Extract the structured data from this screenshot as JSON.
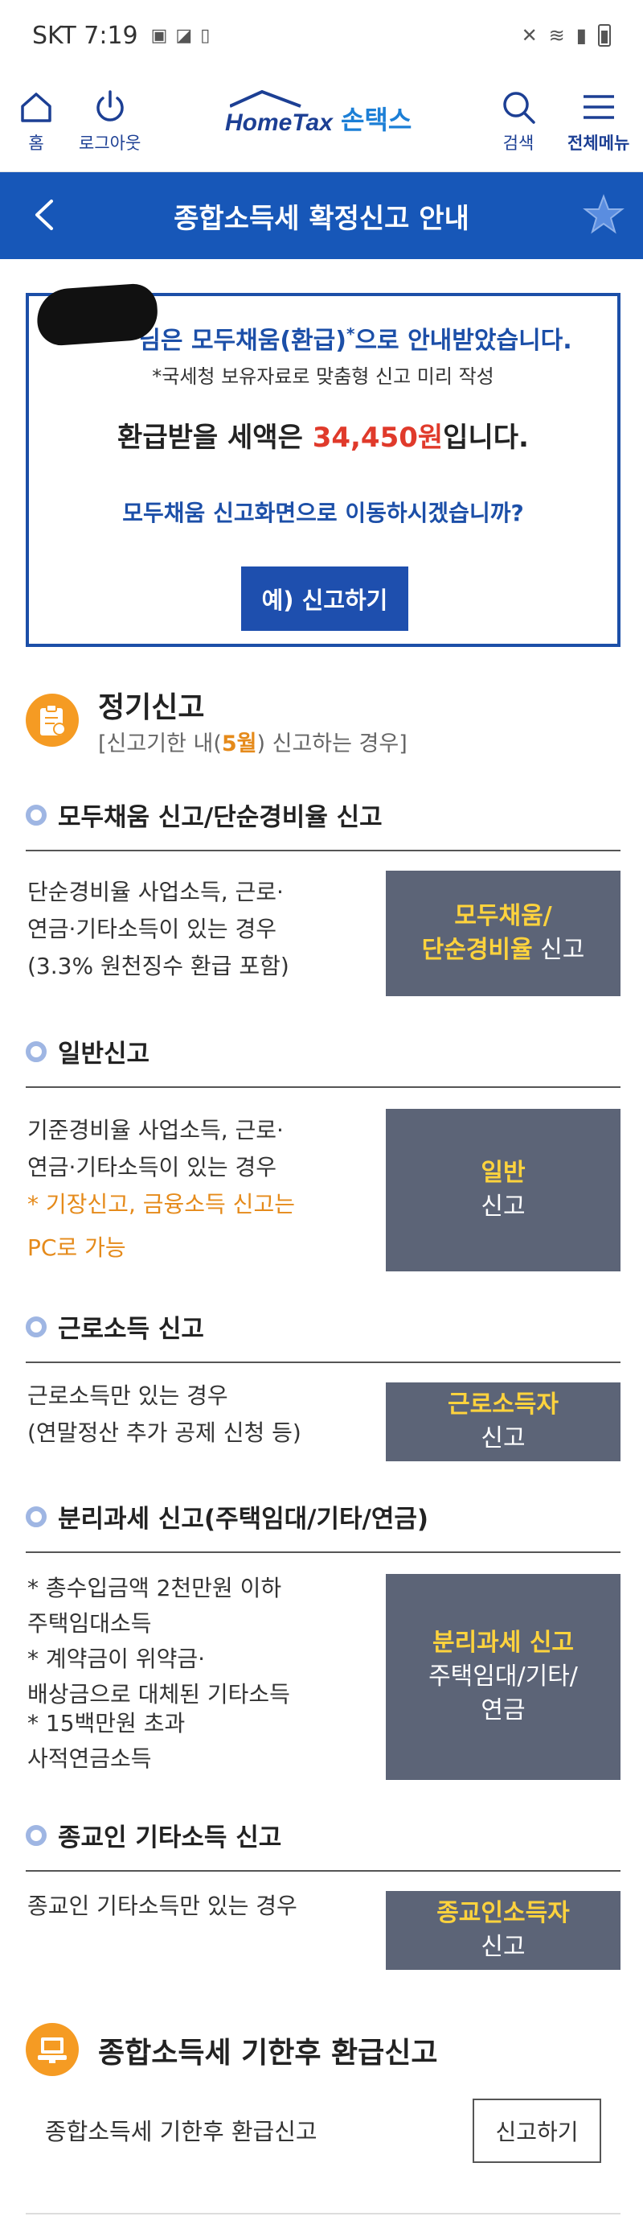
{
  "status_bar": {
    "carrier_time": "SKT 7:19"
  },
  "header": {
    "home_label": "홈",
    "logout_label": "로그아웃",
    "logo_en": "HomeTax",
    "logo_ko": "손택스",
    "search_label": "검색",
    "menu_label": "전체메뉴"
  },
  "title_bar": {
    "title": "종합소득세 확정신고 안내"
  },
  "notice": {
    "line1": "님은 모두채움(환급)",
    "line1_sup": "*",
    "line1_tail": "으로 안내받았습니다.",
    "line2": "*국세청 보유자료로 맞춤형 신고 미리 작성",
    "line3_pre": "환급받을 세액은 ",
    "amount": "34,450원",
    "line3_post": "입니다.",
    "question": "모두채움 신고화면으로 이동하시겠습니까?",
    "button": "예) 신고하기"
  },
  "regular": {
    "title": "정기신고",
    "sub_pre": "[신고기한 내(",
    "sub_month": "5월",
    "sub_post": ") 신고하는 경우]"
  },
  "items": {
    "simple": {
      "title": "모두채움 신고/단순경비율 신고",
      "desc1": "단순경비율 사업소득, 근로·",
      "desc2": "연금·기타소득이 있는 경우",
      "desc3": "(3.3% 원천징수 환급 포함)",
      "btn_y1": "모두채움/",
      "btn_y2": "단순경비율",
      "btn_w": " 신고"
    },
    "general": {
      "title": "일반신고",
      "desc1": "기준경비율 사업소득, 근로·",
      "desc2": "연금·기타소득이 있는 경우",
      "warn1": "* 기장신고, 금융소득 신고는",
      "warn2": "PC로 가능",
      "btn_y": "일반",
      "btn_w": "신고"
    },
    "wage": {
      "title": "근로소득 신고",
      "desc1": "근로소득만 있는 경우",
      "desc2": "(연말정산 추가 공제 신청 등)",
      "btn_y": "근로소득자",
      "btn_w": "신고"
    },
    "separate": {
      "title": "분리과세 신고(주택임대/기타/연금)",
      "desc1": "* 총수입금액 2천만원 이하",
      "desc2": "주택임대소득",
      "desc3": "* 계약금이 위약금·",
      "desc4": "배상금으로 대체된 기타소득",
      "desc5": "* 15백만원 초과",
      "desc6": "사적연금소득",
      "btn_y": "분리과세 신고",
      "btn_w1": "주택임대/기타/",
      "btn_w2": "연금"
    },
    "religious": {
      "title": "종교인 기타소득 신고",
      "desc1": "종교인 기타소득만 있는 경우",
      "btn_y": "종교인소득자",
      "btn_w": "신고"
    }
  },
  "late": {
    "title": "종합소득세 기한후 환급신고",
    "row_label": "종합소득세 기한후 환급신고",
    "button": "신고하기"
  },
  "colors": {
    "brand_blue": "#1757b8",
    "accent_orange": "#f59b23",
    "refund_red": "#e03a2b",
    "button_gray": "#5c6477",
    "button_yellow": "#ffd33d"
  }
}
